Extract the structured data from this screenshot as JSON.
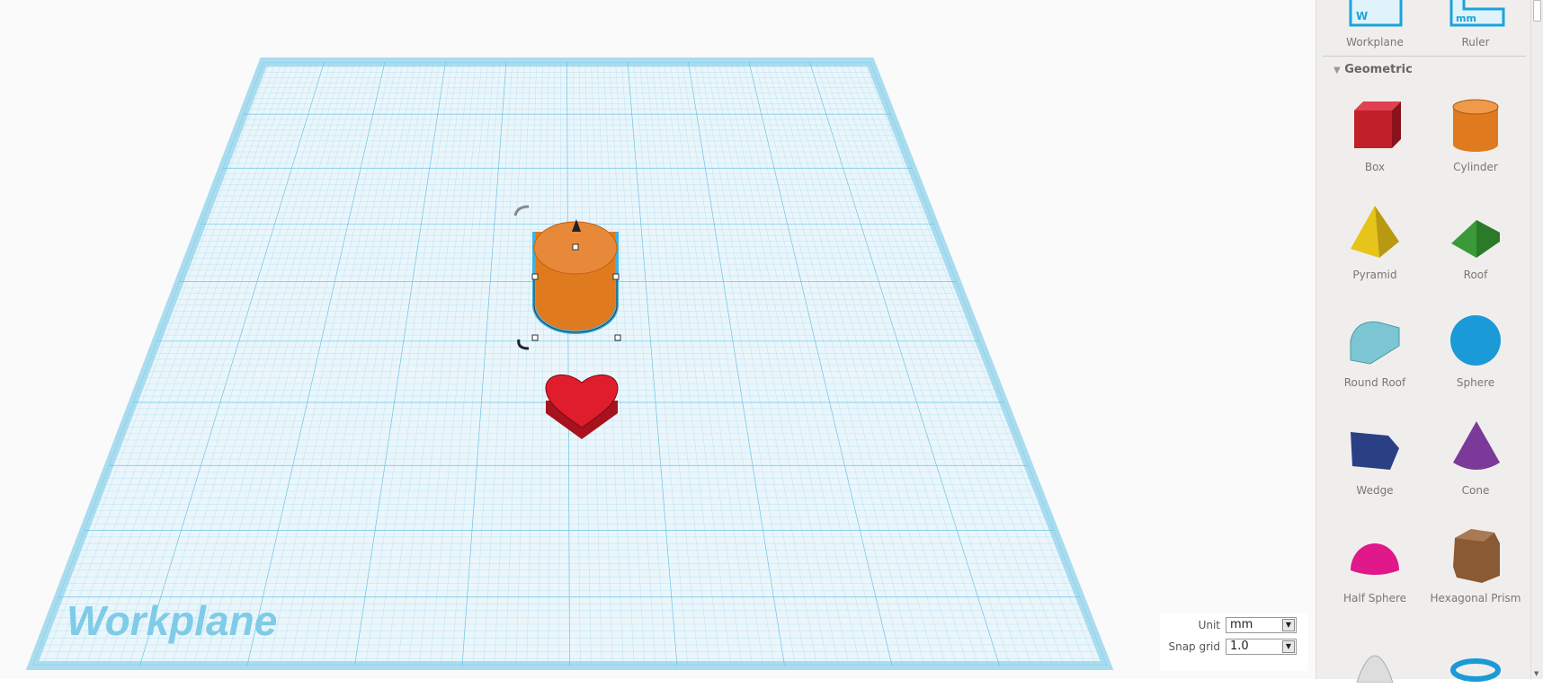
{
  "workplane": {
    "label": "Workplane"
  },
  "settings": {
    "unit_label": "Unit",
    "unit_value": "mm",
    "snap_label": "Snap grid",
    "snap_value": "1.0"
  },
  "sidebar": {
    "helpers": [
      {
        "label": "Workplane"
      },
      {
        "label": "Ruler",
        "icon_text": "mm"
      }
    ],
    "workplane_icon_text": "W",
    "section": "Geometric",
    "shapes": [
      {
        "label": "Box",
        "color": "#c0202a"
      },
      {
        "label": "Cylinder",
        "color": "#e07a1f"
      },
      {
        "label": "Pyramid",
        "color": "#e6c41a"
      },
      {
        "label": "Roof",
        "color": "#3a9a3a"
      },
      {
        "label": "Round Roof",
        "color": "#7cc6d4"
      },
      {
        "label": "Sphere",
        "color": "#1a9ad6"
      },
      {
        "label": "Wedge",
        "color": "#2b3f85"
      },
      {
        "label": "Cone",
        "color": "#7b3a9a"
      },
      {
        "label": "Half Sphere",
        "color": "#e0188a"
      },
      {
        "label": "Hexagonal Prism",
        "color": "#8a5a35"
      }
    ]
  },
  "scene": {
    "objects": [
      {
        "name": "cylinder",
        "color": "#e8893a"
      },
      {
        "name": "heart",
        "color": "#d91c2c"
      }
    ]
  }
}
